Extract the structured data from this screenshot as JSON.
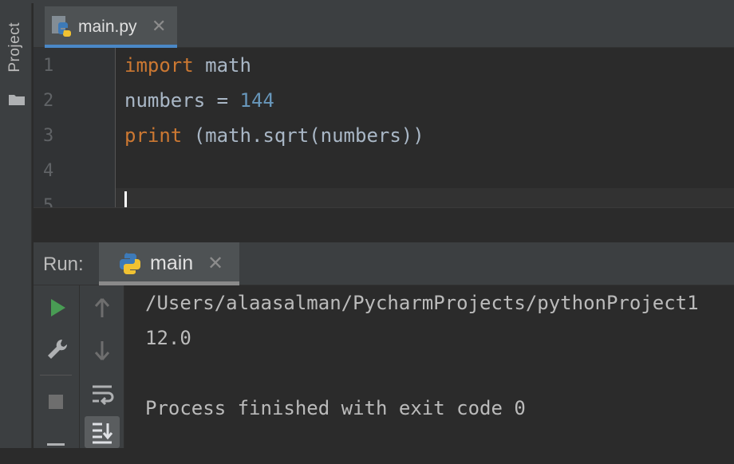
{
  "sidebar": {
    "project_label": "Project"
  },
  "editor": {
    "tab": {
      "label": "main.py",
      "close": "✕"
    },
    "lines": [
      {
        "number": "1",
        "tokens": [
          {
            "text": "import",
            "cls": "kw"
          },
          {
            "text": " math",
            "cls": ""
          }
        ]
      },
      {
        "number": "2",
        "tokens": [
          {
            "text": "numbers = ",
            "cls": ""
          },
          {
            "text": "144",
            "cls": "num"
          }
        ]
      },
      {
        "number": "3",
        "tokens": [
          {
            "text": "print",
            "cls": "kw"
          },
          {
            "text": " (math.sqrt(numbers))",
            "cls": ""
          }
        ]
      },
      {
        "number": "4",
        "tokens": []
      },
      {
        "number": "5",
        "tokens": []
      }
    ]
  },
  "run": {
    "label": "Run:",
    "tab_label": "main",
    "tab_close": "✕",
    "console": [
      "/Users/alaasalman/PycharmProjects/pythonProject1",
      "12.0",
      "",
      "Process finished with exit code 0"
    ]
  }
}
